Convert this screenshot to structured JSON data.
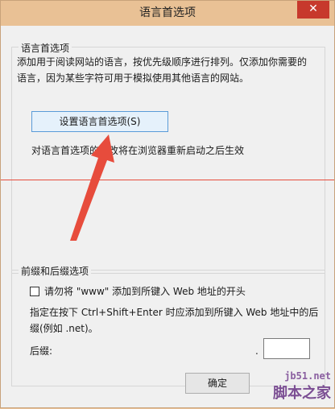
{
  "window": {
    "title": "语言首选项",
    "close_symbol": "✕"
  },
  "language_group": {
    "legend": "语言首选项",
    "description_line1": "添加用于阅读网站的语言，按优先级顺序进行排列。仅添加你需要的",
    "description_line2": "语言，因为某些字符可用于模拟使用其他语言的网站。",
    "set_button_label": "设置语言首选项(S)",
    "restart_note": "对语言首选项的更改将在浏览器重新启动之后生效"
  },
  "prefix_group": {
    "legend": "前缀和后缀选项",
    "checkbox_label": "请勿将 \"www\" 添加到所键入 Web 地址的开头",
    "checkbox_checked": false,
    "hint_line1": "指定在按下 Ctrl+Shift+Enter 时应添加到所键入 Web 地址中的后",
    "hint_line2": "缀(例如 .net)。",
    "suffix_label": "后缀:",
    "suffix_dot": ".",
    "suffix_value": ""
  },
  "footer": {
    "ok_label": "确定"
  },
  "watermark": {
    "site": "jb51.net",
    "brand": "脚本之家"
  },
  "colors": {
    "arrow": "#e74c3c",
    "titlebar": "#e9c195",
    "close": "#c7392c"
  }
}
